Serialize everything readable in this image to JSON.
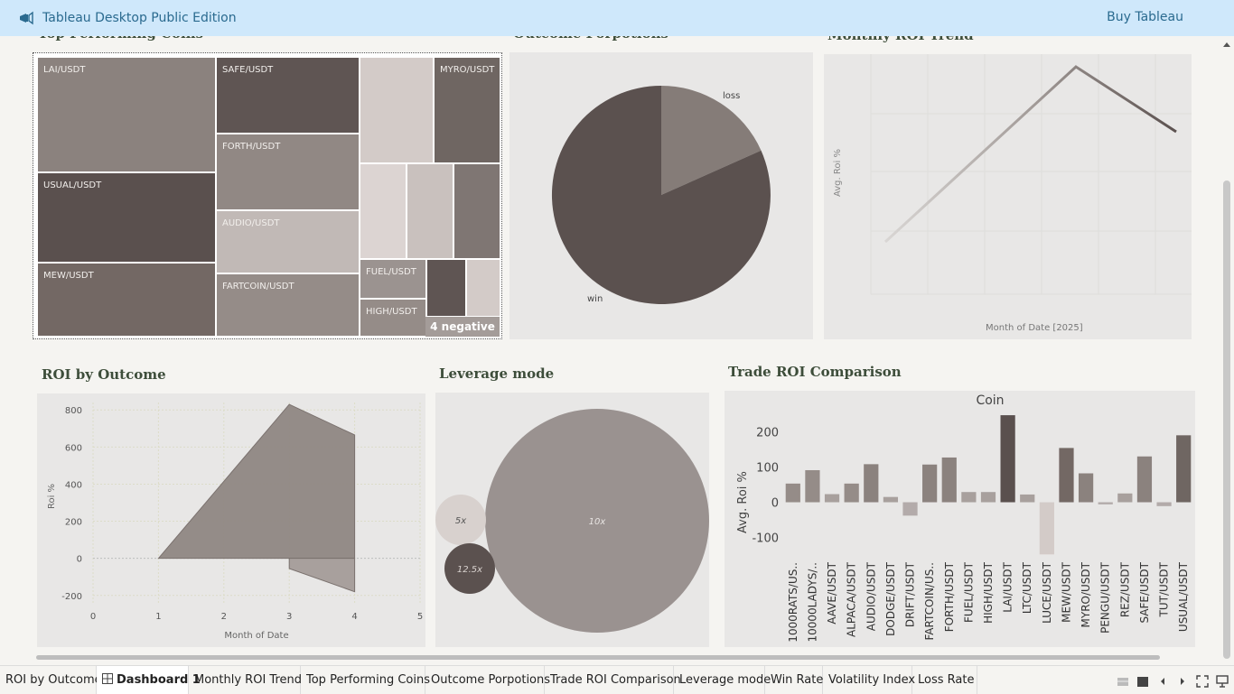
{
  "banner": {
    "title": "Tableau Desktop Public Edition",
    "buy_label": "Buy Tableau",
    "icon": "megaphone-icon",
    "bg": "#cfe8fb"
  },
  "dashboard": {
    "top_performing": {
      "title": "Top Performing Coins",
      "badge": "4 negative",
      "tiles": [
        {
          "label": "LAI/USDT",
          "color": "#8b827e"
        },
        {
          "label": "USUAL/USDT",
          "color": "#5a504e"
        },
        {
          "label": "MEW/USDT",
          "color": "#736864"
        },
        {
          "label": "SAFE/USDT",
          "color": "#5f5553"
        },
        {
          "label": "FORTH/USDT",
          "color": "#918884"
        },
        {
          "label": "AUDIO/USDT",
          "color": "#c1b9b6"
        },
        {
          "label": "FARTCOIN/USDT",
          "color": "#958c88"
        },
        {
          "label": "MYRO/USDT",
          "color": "#6f6662"
        },
        {
          "label": "FUEL/USDT",
          "color": "#9b9390"
        },
        {
          "label": "HIGH/USDT",
          "color": "#958c88"
        }
      ]
    },
    "outcome": {
      "title": "Outcome Porpotions",
      "chart_data": {
        "type": "pie",
        "categories": [
          "loss",
          "win"
        ],
        "values": [
          19,
          81
        ]
      }
    },
    "monthly": {
      "title": "Monthly ROI Trend",
      "chart_data": {
        "type": "line",
        "xlabel": "Month of Date [2025]",
        "ylabel": "Avg. Roi %"
      }
    },
    "roi_outcome": {
      "title": "ROI by Outcome",
      "chart_data": {
        "type": "area",
        "xlabel": "Month of Date",
        "ylabel": "Roi %",
        "x_ticks": [
          "0",
          "1",
          "2",
          "3",
          "4",
          "5"
        ],
        "y_ticks": [
          "800",
          "600",
          "400",
          "200",
          "0",
          "-200"
        ],
        "xlim": [
          0,
          5
        ],
        "ylim": [
          -240,
          840
        ],
        "series": [
          {
            "x": [
              1,
              3,
              4
            ],
            "values": [
              0,
              830,
              665
            ]
          },
          {
            "x": [
              3,
              4
            ],
            "values": [
              -55,
              -180
            ]
          }
        ]
      }
    },
    "leverage": {
      "title": "Leverage mode",
      "chart_data": {
        "type": "bubble",
        "categories": [
          "5x",
          "10x",
          "12.5x"
        ]
      }
    },
    "trade_roi": {
      "title": "Trade ROI Comparison",
      "chart_data": {
        "type": "bar",
        "header": "Coin",
        "ylabel": "Avg. Roi %",
        "y_ticks": [
          "200",
          "100",
          "0",
          "-100"
        ],
        "ylim": [
          -160,
          260
        ],
        "categories": [
          "1000RATS/US..",
          "10000LADYS/..",
          "AAVE/USDT",
          "ALPACA/USDT",
          "AUDIO/USDT",
          "DODGE/USDT",
          "DRIFT/USDT",
          "FARTCOIN/US..",
          "FORTH/USDT",
          "FUEL/USDT",
          "HIGH/USDT",
          "LAI/USDT",
          "LTC/USDT",
          "LUCE/USDT",
          "MEW/USDT",
          "MYRO/USDT",
          "PENGU/USDT",
          "REZ/USDT",
          "SAFE/USDT",
          "TUT/USDT",
          "USUAL/USDT"
        ],
        "values": [
          53,
          91,
          23,
          53,
          108,
          15,
          -38,
          107,
          127,
          29,
          29,
          247,
          22,
          -148,
          154,
          82,
          -6,
          25,
          130,
          -11,
          190
        ],
        "colors": [
          "#958c88",
          "#958c88",
          "#a8a09d",
          "#958c88",
          "#8b827e",
          "#a8a09d",
          "#b3abaa",
          "#8b827e",
          "#8b827e",
          "#a8a09d",
          "#a8a09d",
          "#5a504e",
          "#a8a09d",
          "#d3cbc8",
          "#736864",
          "#8b827e",
          "#b3abaa",
          "#a8a09d",
          "#8b827e",
          "#b3abaa",
          "#6f6662"
        ]
      }
    }
  },
  "tabs": [
    {
      "label": "ROI by Outcome",
      "active": false
    },
    {
      "label": "Dashboard 1",
      "active": true
    },
    {
      "label": "Monthly ROI Trend",
      "active": false
    },
    {
      "label": "Top Performing Coins",
      "active": false
    },
    {
      "label": "Outcome Porpotions",
      "active": false
    },
    {
      "label": "Trade ROI Comparison",
      "active": false
    },
    {
      "label": "Leverage mode",
      "active": false
    },
    {
      "label": "Win Rate",
      "active": false
    },
    {
      "label": "Volatility Index",
      "active": false
    },
    {
      "label": "Loss Rate",
      "active": false
    }
  ],
  "toolbar_icons": [
    "grid-view-icon",
    "filmstrip-icon",
    "prev-sheet-icon",
    "next-sheet-icon",
    "fullscreen-icon",
    "presentation-icon"
  ]
}
